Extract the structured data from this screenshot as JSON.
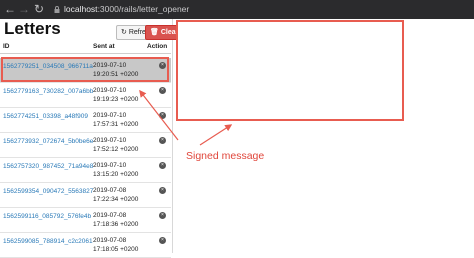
{
  "browser": {
    "back_glyph": "←",
    "forward_glyph": "→",
    "reload_glyph": "↻",
    "url_host": "localhost",
    "url_path": ":3000/rails/letter_opener"
  },
  "page": {
    "title": "Letters",
    "refresh_label": "Refresh",
    "clear_label": "Clear"
  },
  "table": {
    "headers": {
      "id": "ID",
      "sent_at": "Sent at",
      "action": "Action"
    },
    "rows": [
      {
        "id": "1562779251_034508_966711a",
        "date": "2019-07-10",
        "time": "19:20:51 +0200",
        "selected": true
      },
      {
        "id": "1562779163_730282_007a6bb",
        "date": "2019-07-10",
        "time": "19:19:23 +0200",
        "selected": false
      },
      {
        "id": "1562774251_03398_a48f909",
        "date": "2019-07-10",
        "time": "17:57:31 +0200",
        "selected": false
      },
      {
        "id": "1562773932_072674_5b0be6e",
        "date": "2019-07-10",
        "time": "17:52:12 +0200",
        "selected": false
      },
      {
        "id": "1562757320_987452_71a94e8",
        "date": "2019-07-10",
        "time": "13:15:20 +0200",
        "selected": false
      },
      {
        "id": "1562599354_090472_5563827",
        "date": "2019-07-08",
        "time": "17:22:34 +0200",
        "selected": false
      },
      {
        "id": "1562599116_085792_576fe4b",
        "date": "2019-07-08",
        "time": "17:18:36 +0200",
        "selected": false
      },
      {
        "id": "1562599085_788914_c2c2061",
        "date": "2019-07-08",
        "time": "17:18:05 +0200",
        "selected": false
      }
    ]
  },
  "annotation": {
    "label": "Signed message",
    "color": "#e0463b"
  }
}
